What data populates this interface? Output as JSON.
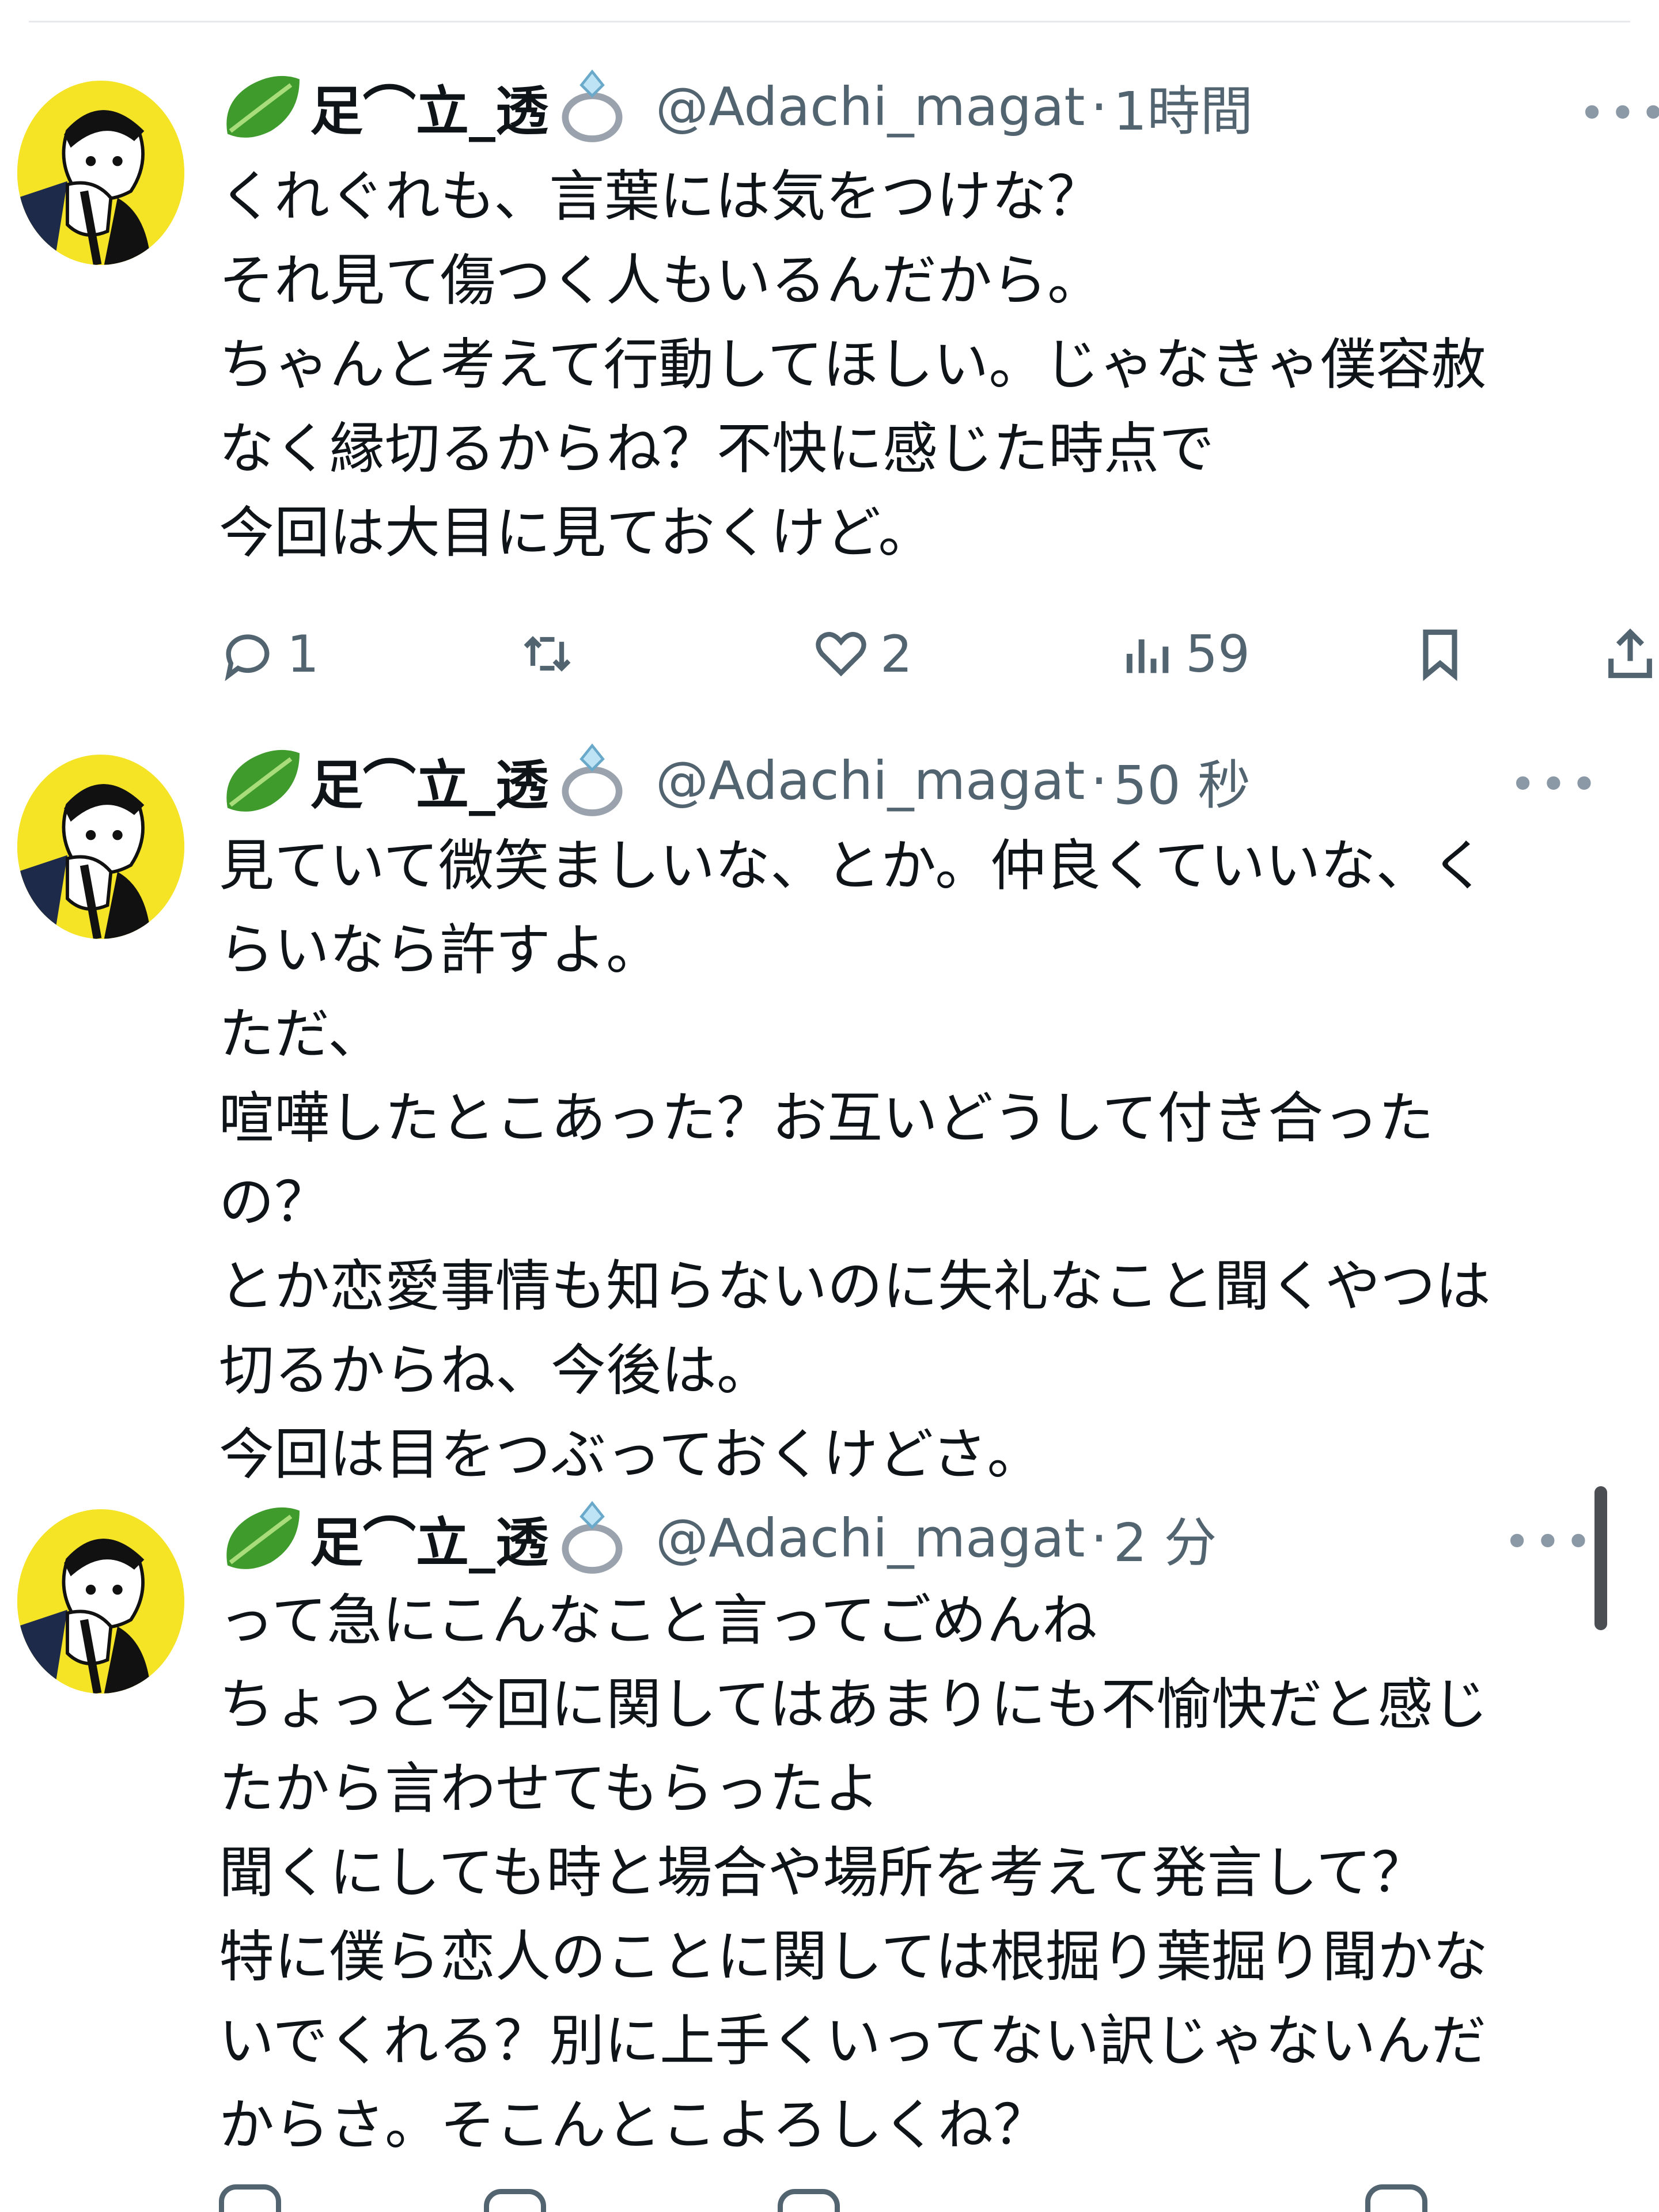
{
  "tweets": [
    {
      "display_name": "足⌒立_透",
      "handle": "@Adachi_magat",
      "time": "1時間",
      "more": "•••",
      "lines": [
        "くれぐれも、言葉には気をつけな？",
        "それ見て傷つく人もいるんだから。",
        "ちゃんと考えて行動してほしい。じゃなきゃ僕容赦",
        "なく縁切るからね？不快に感じた時点で",
        "今回は大目に見ておくけど。"
      ],
      "stats": {
        "replies": "1",
        "likes": "2",
        "views": "59"
      }
    },
    {
      "display_name": "足⌒立_透",
      "handle": "@Adachi_magat",
      "time": "50 秒",
      "more": "•••",
      "lines": [
        "見ていて微笑ましいな、とか。仲良くていいな、く",
        "らいなら許すよ。",
        "ただ、",
        "喧嘩したとこあった？お互いどうして付き合った",
        "の？",
        "とか恋愛事情も知らないのに失礼なこと聞くやつは",
        "切るからね、今後は。",
        "今回は目をつぶっておくけどさ。"
      ]
    },
    {
      "display_name": "足⌒立_透",
      "handle": "@Adachi_magat",
      "time": "2 分",
      "more": "•••",
      "lines": [
        "って急にこんなこと言ってごめんね",
        "ちょっと今回に関してはあまりにも不愉快だと感じ",
        "たから言わせてもらったよ",
        "聞くにしても時と場合や場所を考えて発言して？",
        "特に僕ら恋人のことに関しては根掘り葉掘り聞かな",
        "いでくれる？別に上手くいってない訳じゃないんだ",
        "からさ。そこんとこよろしくね？"
      ]
    }
  ],
  "icons": {
    "leaf": "lettuce-leaf-emoji",
    "ring": "ring-emoji",
    "reply": "speech-bubble-icon",
    "retweet": "retweet-icon",
    "like": "heart-icon",
    "views": "bar-chart-icon",
    "bookmark": "bookmark-icon",
    "share": "share-icon"
  },
  "colors": {
    "text": "#0f1419",
    "secondary": "#536471",
    "avatar_bg": "#f5e325",
    "leaf": "#3f9b2c"
  }
}
